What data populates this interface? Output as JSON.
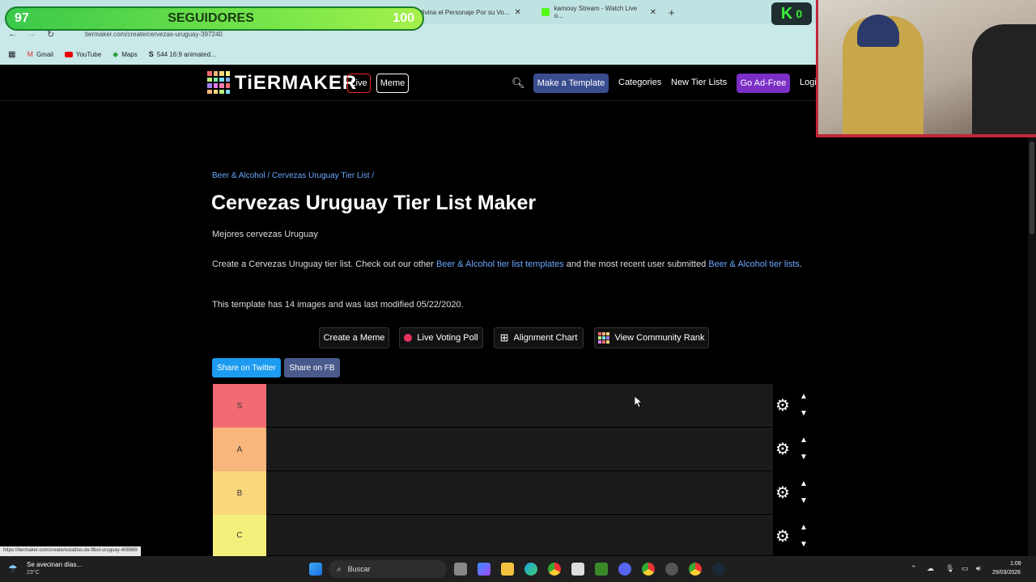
{
  "overlay": {
    "followers_current": "97",
    "followers_label": "SEGUIDORES",
    "followers_goal": "100",
    "kick_count": "0"
  },
  "browser": {
    "tabs": [
      {
        "label": "Adivina el Personaje Por su Vo..."
      },
      {
        "label": "kamouy Stream - Watch Live o..."
      }
    ],
    "address": "tiermaker.com/create/cervezas-uruguay-397240",
    "bookmarks": [
      "Gmail",
      "YouTube",
      "Maps",
      "544 16:9 animated..."
    ]
  },
  "nav": {
    "logo": "TiERMAKER",
    "live": "Live",
    "meme": "Meme",
    "make_template": "Make a Template",
    "categories": "Categories",
    "new_tier_lists": "New Tier Lists",
    "go_ad_free": "Go Ad-Free",
    "login": "Login"
  },
  "page": {
    "breadcrumb_1": "Beer & Alcohol",
    "breadcrumb_sep": " / ",
    "breadcrumb_2": "Cervezas Uruguay Tier List",
    "breadcrumb_end": " /",
    "title": "Cervezas Uruguay Tier List Maker",
    "subtitle": "Mejores cervezas Uruguay",
    "desc_1": "Create a Cervezas Uruguay tier list. Check out our other ",
    "desc_link_1": "Beer & Alcohol tier list templates",
    "desc_2": " and the most recent user submitted ",
    "desc_link_2": "Beer & Alcohol tier lists",
    "desc_3": ".",
    "info": "This template has 14 images and was last modified 05/22/2020.",
    "btn_meme": "Create a Meme",
    "btn_poll": "Live Voting Poll",
    "btn_alignment": "Alignment Chart",
    "btn_rank": "View Community Rank",
    "share_twitter": "Share on Twitter",
    "share_fb": "Share on FB"
  },
  "tiers": [
    {
      "label": "S",
      "color": "#f26b72"
    },
    {
      "label": "A",
      "color": "#f8b57c"
    },
    {
      "label": "B",
      "color": "#f9d77a"
    },
    {
      "label": "C",
      "color": "#f5f07c"
    }
  ],
  "status_url": "https://tiermaker.com/create/estadios-de-ftbol-uruguay-408969",
  "taskbar": {
    "weather_text": "Se avecinan días...",
    "weather_temp": "23°C",
    "search": "Buscar",
    "time": "1:09",
    "date": "29/03/2026"
  }
}
